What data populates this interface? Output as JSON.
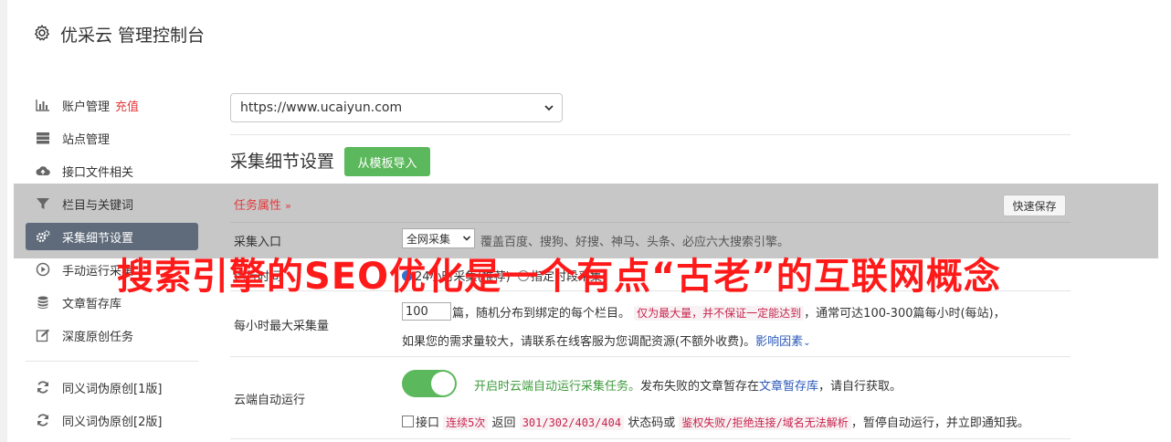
{
  "header": {
    "title": "优采云 管理控制台"
  },
  "sidebar": {
    "items": [
      {
        "label": "账户管理",
        "extra": "充值",
        "icon": "bar-chart-icon"
      },
      {
        "label": "站点管理",
        "icon": "server-icon"
      },
      {
        "label": "接口文件相关",
        "icon": "cloud-upload-icon"
      },
      {
        "label": "栏目与关键词",
        "icon": "filter-icon"
      },
      {
        "label": "采集细节设置",
        "icon": "cogs-icon",
        "active": true
      },
      {
        "label": "手动运行采集",
        "icon": "play-circle-icon"
      },
      {
        "label": "文章暂存库",
        "icon": "database-icon"
      },
      {
        "label": "深度原创任务",
        "icon": "edit-icon"
      },
      {
        "label": "同义词伪原创[1版]",
        "icon": "refresh-icon"
      },
      {
        "label": "同义词伪原创[2版]",
        "icon": "refresh-icon"
      }
    ]
  },
  "main": {
    "site_select": "https://www.ucaiyun.com",
    "section_title": "采集细节设置",
    "template_button": "从模板导入",
    "task_attr": "任务属性",
    "quick_save": "快速保存",
    "rows": {
      "entry": {
        "label": "采集入口",
        "select_value": "全网采集",
        "note": "覆盖百度、搜狗、好搜、神马、头条、必应六大搜索引擎。"
      },
      "time": {
        "label": "运行时间",
        "opt1": "24小时采集(推荐)",
        "opt2": "指定时段采集"
      },
      "max": {
        "label": "每小时最大采集量",
        "value": "100",
        "t1": "篇，随机分布到绑定的每个栏目。",
        "t2": "仅为最大量，并不保证一定能达到",
        "t3": "，通常可达100-300篇每小时(每站)，",
        "t4": "如果您的需求量较大，请联系在线客服为您调配资源(不额外收费)。",
        "t5": "影响因素"
      },
      "cloud": {
        "label": "云端自动运行",
        "t1": "开启时云端自动运行采集任务。",
        "t2": "发布失败的文章暂存在",
        "t3": "文章暂存库",
        "t4": "，请自行获取。",
        "c1": "接口",
        "c2": "连续5次",
        "c3": "返回",
        "c4": "301/302/403/404",
        "c5": "状态码或",
        "c6": "鉴权失败/拒绝连接/域名无法解析",
        "c7": "，暂停自动运行，并立即通知我。"
      }
    }
  },
  "overlay": {
    "text": "搜索引擎的SEO优化是一个有点“古老”的互联网概念"
  },
  "colors": {
    "accent_green": "#5cb85c",
    "active_nav": "#5f6b7a",
    "danger": "#e4393c",
    "link": "#2b58b8"
  }
}
